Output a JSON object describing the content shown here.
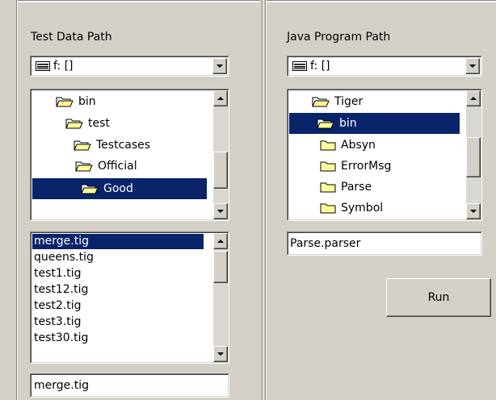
{
  "test_data": {
    "label": "Test Data Path",
    "drive": "f: []",
    "folders": [
      {
        "label": "bin",
        "open": true,
        "selected": false
      },
      {
        "label": "test",
        "open": true,
        "selected": false
      },
      {
        "label": "Testcases",
        "open": true,
        "selected": false
      },
      {
        "label": "Official",
        "open": true,
        "selected": false
      },
      {
        "label": "Good",
        "open": true,
        "selected": true
      }
    ],
    "files": [
      "merge.tig",
      "queens.tig",
      "test1.tig",
      "test12.tig",
      "test2.tig",
      "test3.tig",
      "test30.tig"
    ],
    "selected_file": "merge.tig",
    "file_field_value": "merge.tig"
  },
  "java_program": {
    "label": "Java Program Path",
    "drive": "f: []",
    "folders": [
      {
        "label": "Tiger",
        "open": true,
        "selected": false
      },
      {
        "label": "bin",
        "open": true,
        "selected": true
      },
      {
        "label": "Absyn",
        "open": false,
        "selected": false
      },
      {
        "label": "ErrorMsg",
        "open": false,
        "selected": false
      },
      {
        "label": "Parse",
        "open": false,
        "selected": false
      },
      {
        "label": "Symbol",
        "open": false,
        "selected": false
      }
    ],
    "class_field_value": "Parse.parser",
    "run_label": "Run"
  },
  "icons": {
    "drive": "drive-icon",
    "folder_open": "folder-open-icon",
    "folder_closed": "folder-closed-icon",
    "arrow_down": "chevron-down-icon",
    "arrow_up": "chevron-up-icon"
  },
  "colors": {
    "selection": "#0a246a",
    "folder_fill": "#ffff99",
    "face": "#d4d0c8"
  }
}
